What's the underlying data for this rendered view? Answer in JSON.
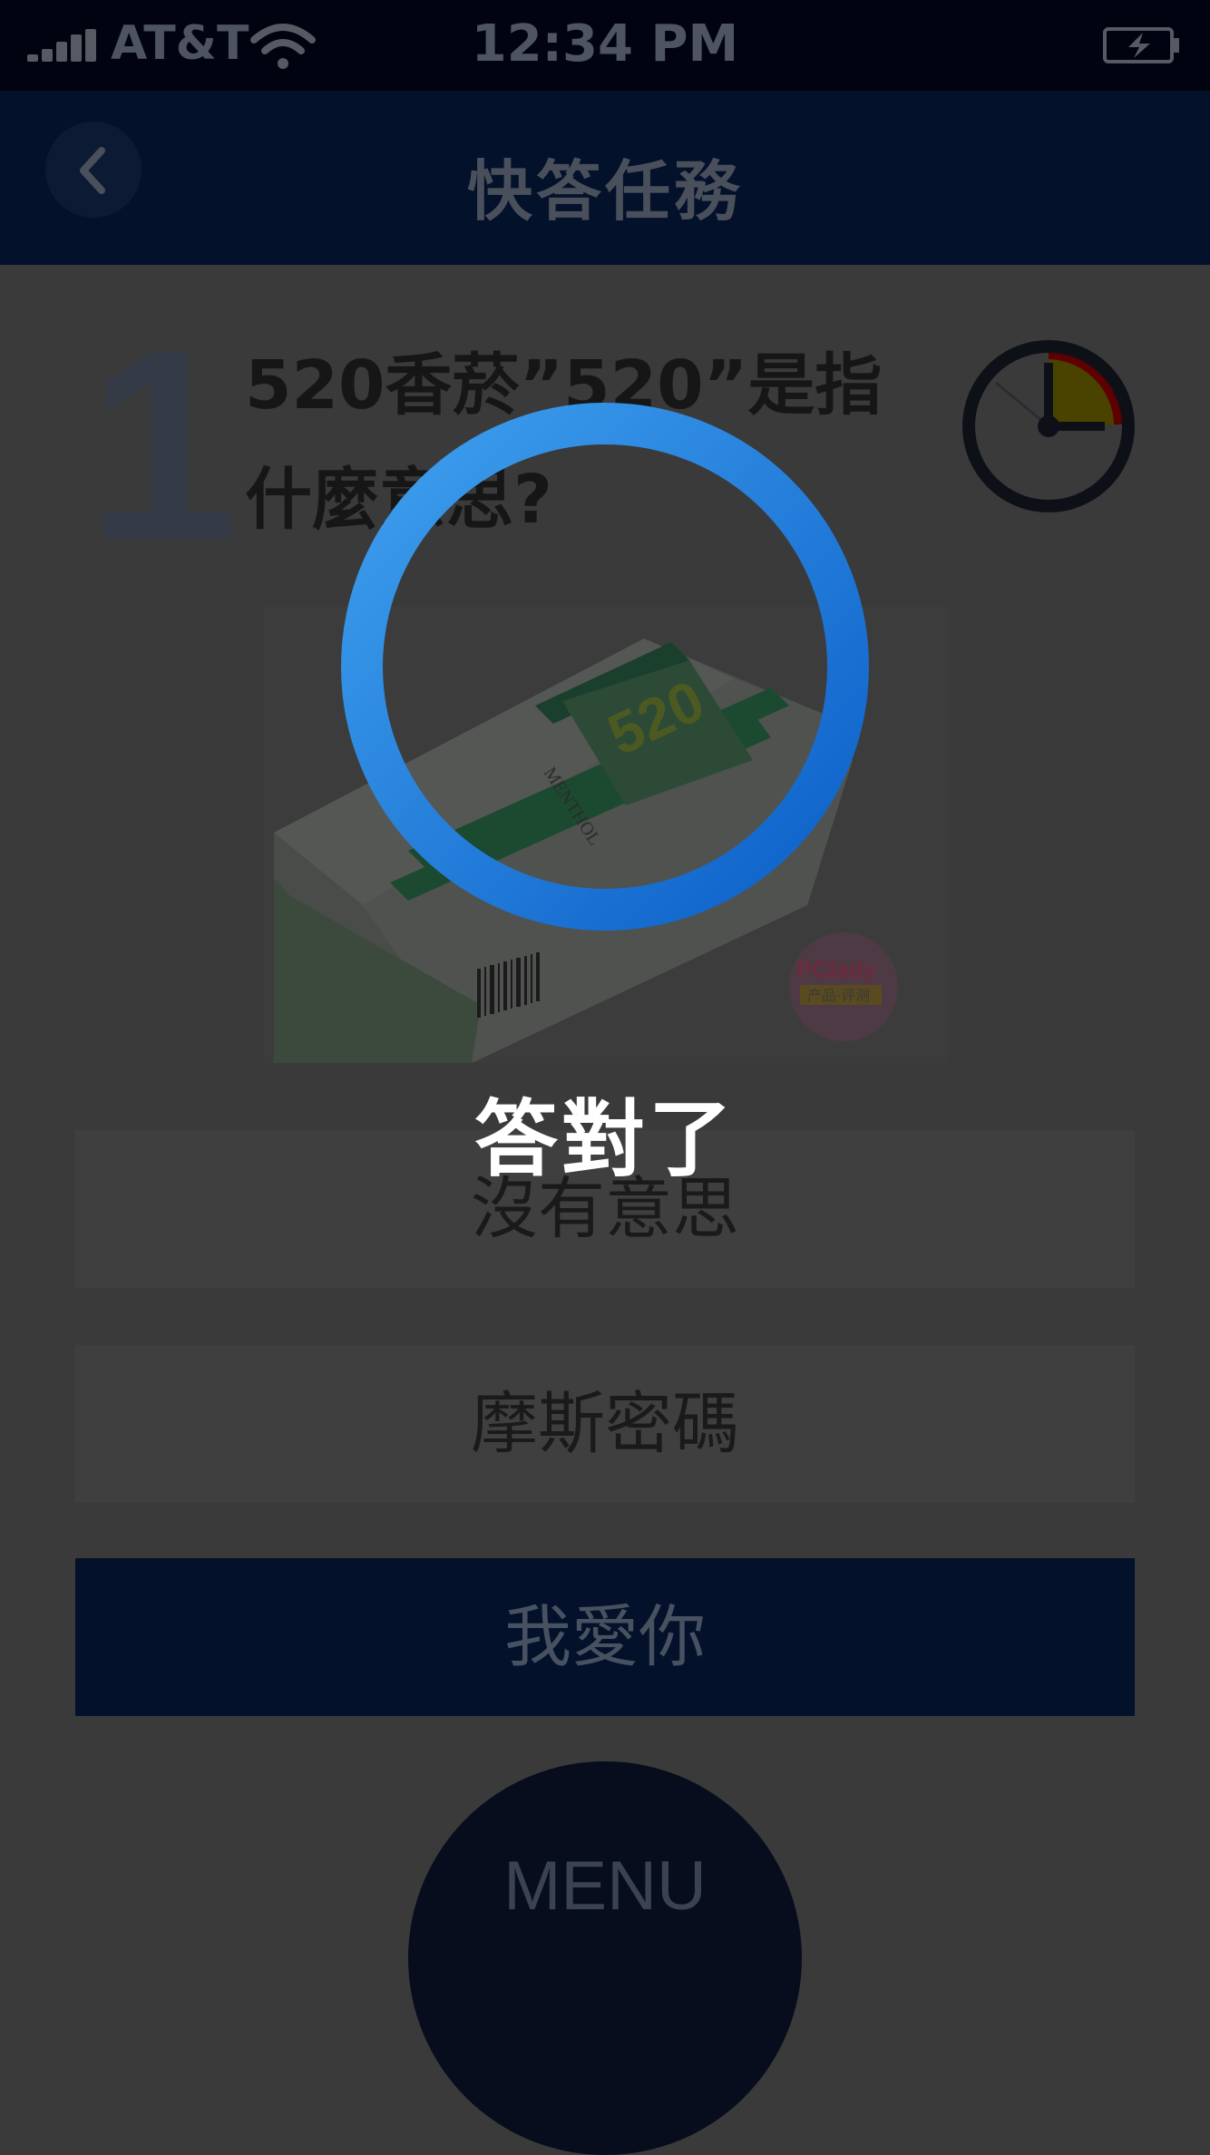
{
  "status_bar": {
    "carrier": "AT&T",
    "time": "12:34 PM",
    "icons": [
      "signal-icon",
      "wifi-icon",
      "battery-charging-icon"
    ]
  },
  "nav": {
    "title": "快答任務",
    "back_icon": "chevron-left-icon"
  },
  "question": {
    "number": "1",
    "text": "520香菸”520”是指什麼意思?",
    "timer_icon": "stopwatch-icon",
    "timer_elapsed_fraction": 0.2
  },
  "image": {
    "description_icon": "cigarette-pack-image",
    "brand_text": "520",
    "sub_text": "MENTHOL",
    "watermark": "PClady",
    "watermark_sub": "产品·评测"
  },
  "answers": [
    {
      "label": "沒有意思"
    },
    {
      "label": "摩斯密碼"
    },
    {
      "label": "我愛你"
    }
  ],
  "menu": {
    "label": "MENU"
  },
  "result": {
    "label": "答對了",
    "ring_icon": "correct-ring-icon"
  },
  "colors": {
    "ring": "#1f7ee0",
    "nav": "#03112b",
    "selected": "#03112b"
  }
}
